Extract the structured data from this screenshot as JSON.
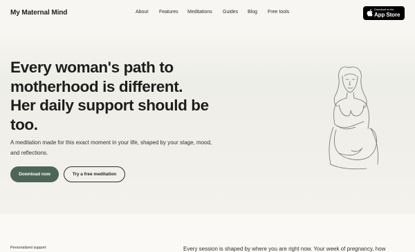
{
  "header": {
    "brand": "My Maternal Mind",
    "nav": [
      {
        "label": "About"
      },
      {
        "label": "Features"
      },
      {
        "label": "Meditations"
      },
      {
        "label": "Guides"
      },
      {
        "label": "Blog"
      },
      {
        "label": "Free tools"
      }
    ],
    "app_store": {
      "small_text": "Download on the",
      "big_text": "App Store",
      "icon": "apple-icon"
    }
  },
  "hero": {
    "headline_lines": [
      "Every woman's path to",
      "motherhood is different.",
      "Her daily support should be",
      "too."
    ],
    "subtext_lines": [
      "A meditation made for this exact moment in your life, shaped by your stage, mood,",
      "and reflections."
    ],
    "primary_button": "Download now",
    "secondary_button": "Try a free meditation",
    "illustration": "pregnant-woman-line-drawing"
  },
  "section": {
    "label": "Personalized support",
    "text": "Every session is shaped by where you are right now. Your week of pregnancy, how"
  },
  "colors": {
    "accent": "#4c6655",
    "text": "#1f1f1f",
    "background": "#f7f5f1"
  }
}
